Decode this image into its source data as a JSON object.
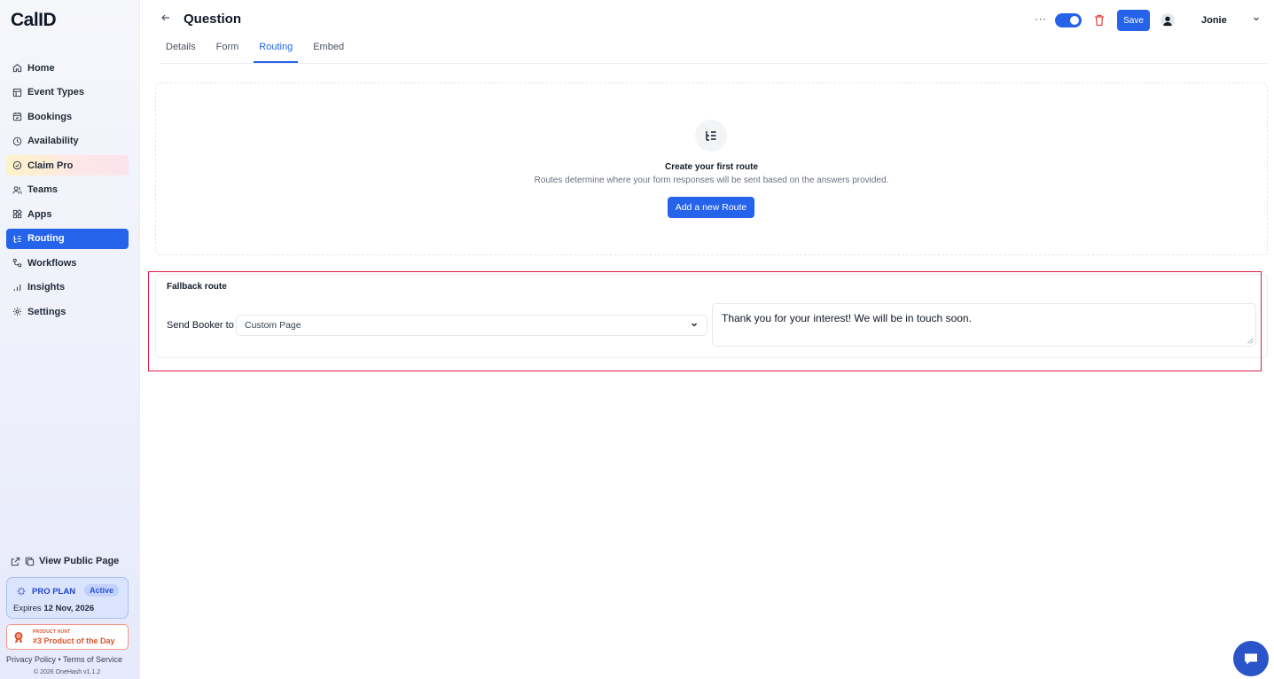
{
  "brand": {
    "logo": "CalID",
    "accent": "#2563eb"
  },
  "sidebar": {
    "items": [
      {
        "label": "Home",
        "icon": "home-icon"
      },
      {
        "label": "Event Types",
        "icon": "event-types-icon"
      },
      {
        "label": "Bookings",
        "icon": "calendar-icon"
      },
      {
        "label": "Availability",
        "icon": "clock-icon"
      },
      {
        "label": "Claim Pro",
        "icon": "badge-icon"
      },
      {
        "label": "Teams",
        "icon": "users-icon"
      },
      {
        "label": "Apps",
        "icon": "grid-icon"
      },
      {
        "label": "Routing",
        "icon": "routing-icon",
        "active": true
      },
      {
        "label": "Workflows",
        "icon": "workflow-icon"
      },
      {
        "label": "Insights",
        "icon": "bar-chart-icon"
      },
      {
        "label": "Settings",
        "icon": "gear-icon"
      }
    ],
    "view_public_page": "View Public Page",
    "plan": {
      "name": "PRO PLAN",
      "status": "Active",
      "expires_prefix": "Expires",
      "expires_date": "12 Nov, 2026"
    },
    "product_hunt": {
      "top": "PRODUCT HUNT",
      "main": "#3 Product of the Day"
    },
    "legal": {
      "privacy": "Privacy Policy",
      "separator": "•",
      "terms": "Terms of Service"
    },
    "copyright": "© 2026 OneHash v1.1.2"
  },
  "header": {
    "back_icon": "arrow-left-icon",
    "title": "Question",
    "tabs": [
      {
        "label": "Details"
      },
      {
        "label": "Form"
      },
      {
        "label": "Routing",
        "active": true
      },
      {
        "label": "Embed"
      }
    ],
    "more": "···",
    "toggle_on": true,
    "save_label": "Save",
    "user_name": "Jonie"
  },
  "routes": {
    "empty_title": "Create your first route",
    "empty_subtitle": "Routes determine where your form responses will be sent based on the answers provided.",
    "add_button": "Add a new Route"
  },
  "fallback": {
    "title": "Fallback route",
    "send_label": "Send Booker to",
    "select_value": "Custom Page",
    "message": "Thank you for your interest! We will be in touch soon."
  }
}
